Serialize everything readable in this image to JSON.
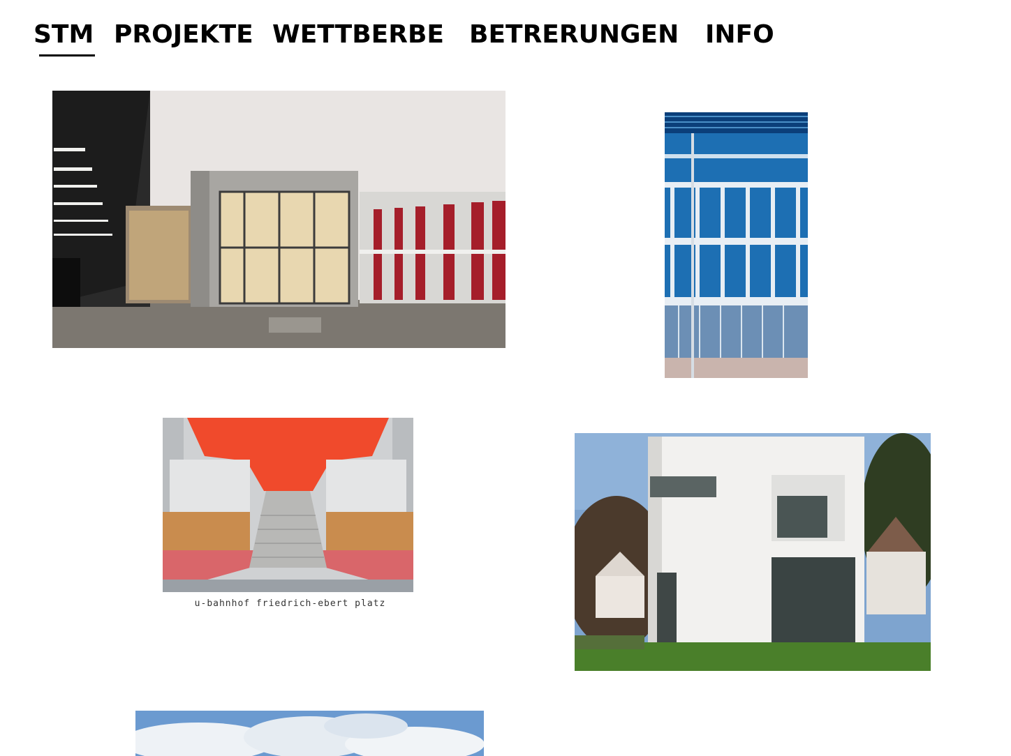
{
  "nav": {
    "items": [
      {
        "label": "STM"
      },
      {
        "label": "PROJEKTE"
      },
      {
        "label": "WETTBERBE"
      },
      {
        "label": "BETRERUNGEN"
      },
      {
        "label": "INFO"
      }
    ]
  },
  "projects": {
    "ubahn_caption": "u-bahnhof friedrich-ebert platz"
  },
  "colors": {
    "accent_red": "#f04a2c",
    "facade_red": "#a51e2a",
    "glass_blue": "#1d6fb3"
  }
}
